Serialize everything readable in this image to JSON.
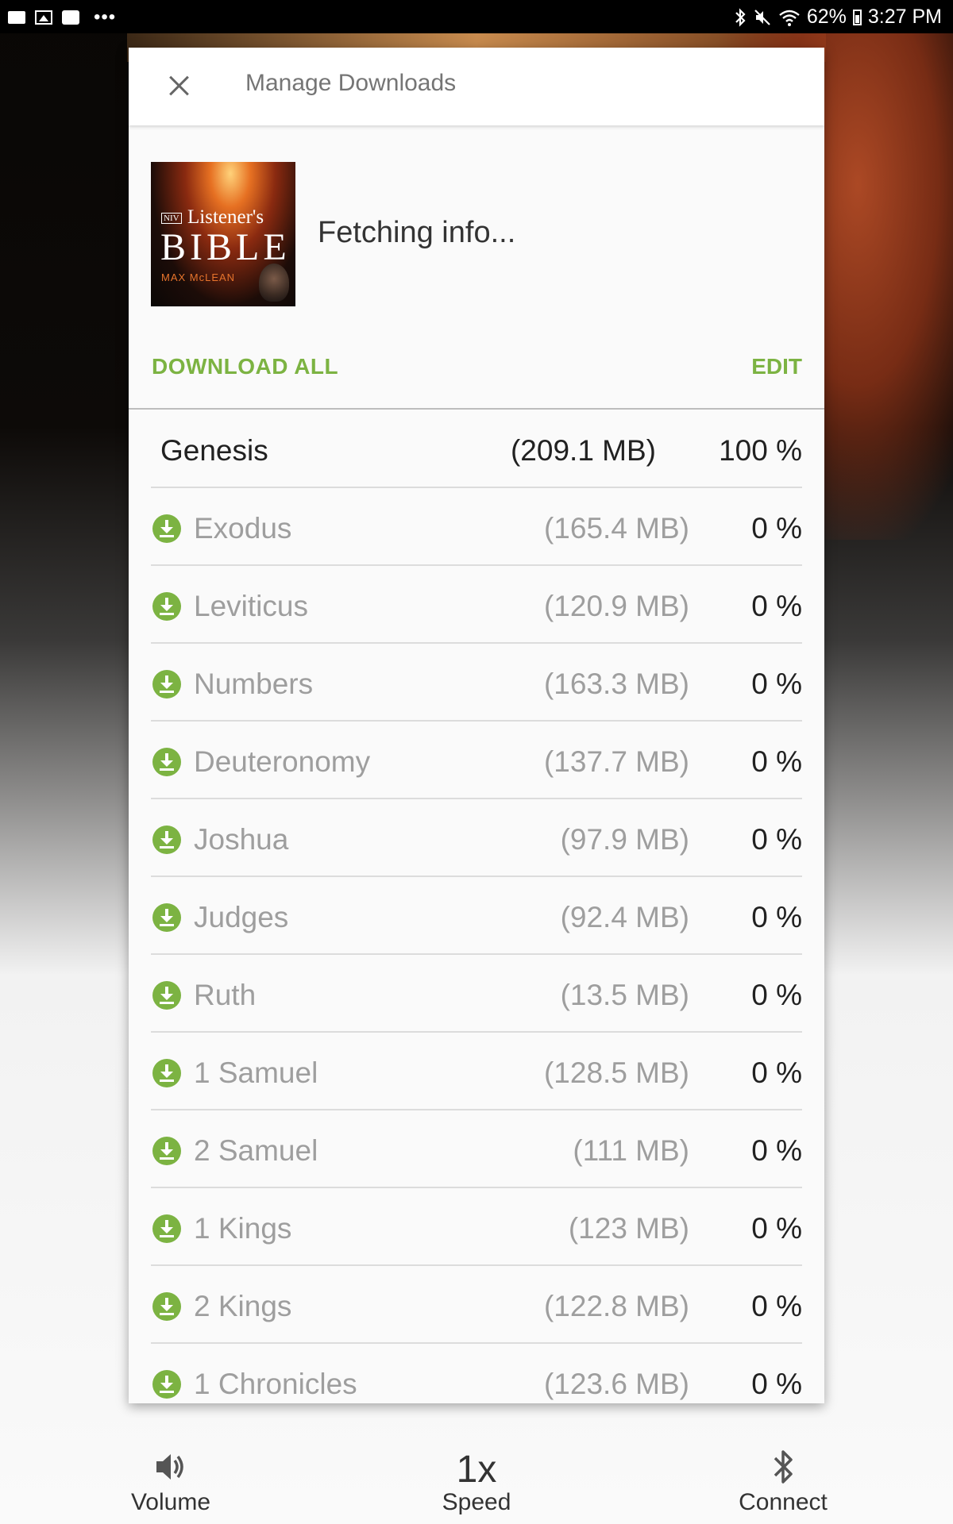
{
  "status_bar": {
    "battery": "62%",
    "time": "3:27 PM",
    "overflow": "•••",
    "icons": [
      "folder-icon",
      "image-icon",
      "book-icon",
      "bluetooth-icon",
      "mute-icon",
      "wifi-icon",
      "battery-icon"
    ]
  },
  "dialog": {
    "title": "Manage Downloads",
    "close_icon": "close-icon",
    "cover": {
      "niv": "NIV",
      "listeners": "Listener's",
      "bible": "BIBLE",
      "author": "MAX McLEAN"
    },
    "status_text": "Fetching info...",
    "download_all_label": "DOWNLOAD ALL",
    "edit_label": "EDIT",
    "accent_color": "#7cb342"
  },
  "downloads": [
    {
      "name": "Genesis",
      "size": "(209.1 MB)",
      "percent": "100 %",
      "downloaded": true
    },
    {
      "name": "Exodus",
      "size": "(165.4 MB)",
      "percent": "0 %",
      "downloaded": false
    },
    {
      "name": "Leviticus",
      "size": "(120.9 MB)",
      "percent": "0 %",
      "downloaded": false
    },
    {
      "name": "Numbers",
      "size": "(163.3 MB)",
      "percent": "0 %",
      "downloaded": false
    },
    {
      "name": "Deuteronomy",
      "size": "(137.7 MB)",
      "percent": "0 %",
      "downloaded": false
    },
    {
      "name": "Joshua",
      "size": "(97.9 MB)",
      "percent": "0 %",
      "downloaded": false
    },
    {
      "name": "Judges",
      "size": "(92.4 MB)",
      "percent": "0 %",
      "downloaded": false
    },
    {
      "name": "Ruth",
      "size": "(13.5 MB)",
      "percent": "0 %",
      "downloaded": false
    },
    {
      "name": "1 Samuel",
      "size": "(128.5 MB)",
      "percent": "0 %",
      "downloaded": false
    },
    {
      "name": "2 Samuel",
      "size": "(111 MB)",
      "percent": "0 %",
      "downloaded": false
    },
    {
      "name": "1 Kings",
      "size": "(123 MB)",
      "percent": "0 %",
      "downloaded": false
    },
    {
      "name": "2 Kings",
      "size": "(122.8 MB)",
      "percent": "0 %",
      "downloaded": false
    },
    {
      "name": "1 Chronicles",
      "size": "(123.6 MB)",
      "percent": "0 %",
      "downloaded": false
    }
  ],
  "bottom_controls": {
    "volume_label": "Volume",
    "speed_value": "1x",
    "speed_label": "Speed",
    "connect_label": "Connect"
  }
}
